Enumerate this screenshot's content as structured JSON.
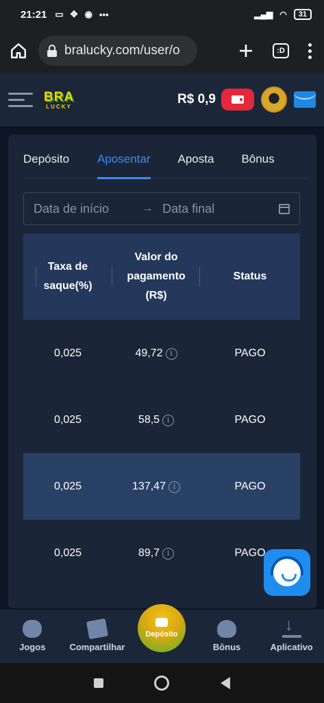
{
  "status_bar": {
    "time": "21:21",
    "battery": "31"
  },
  "browser": {
    "url": "bralucky.com/user/o",
    "tab_label": ":D"
  },
  "header": {
    "logo_top": "BRA",
    "logo_bottom": "LUCKY",
    "balance": "R$  0,9"
  },
  "tabs": [
    {
      "label": "Depósito",
      "active": false
    },
    {
      "label": "Aposentar",
      "active": true
    },
    {
      "label": "Aposta",
      "active": false
    },
    {
      "label": "Bônus",
      "active": false
    }
  ],
  "filter": {
    "start_placeholder": "Data de início",
    "end_placeholder": "Data final"
  },
  "table": {
    "headers": [
      "Taxa de\nsaque(%)",
      "Valor do\npagamento\n(R$)",
      "Status"
    ],
    "rows": [
      {
        "fee": "0,025",
        "amount": "49,72",
        "status": "PAGO"
      },
      {
        "fee": "0,025",
        "amount": "58,5",
        "status": "PAGO"
      },
      {
        "fee": "0,025",
        "amount": "137,47",
        "status": "PAGO"
      },
      {
        "fee": "0,025",
        "amount": "89,7",
        "status": "PAGO"
      }
    ]
  },
  "bottom_nav": {
    "games": "Jogos",
    "share": "Compartilhar",
    "deposit": "Depósito",
    "bonus": "Bônus",
    "app": "Aplicativo"
  },
  "colors": {
    "accent": "#3b8bf2",
    "wallet": "#e3283b",
    "support": "#1f8df0"
  }
}
